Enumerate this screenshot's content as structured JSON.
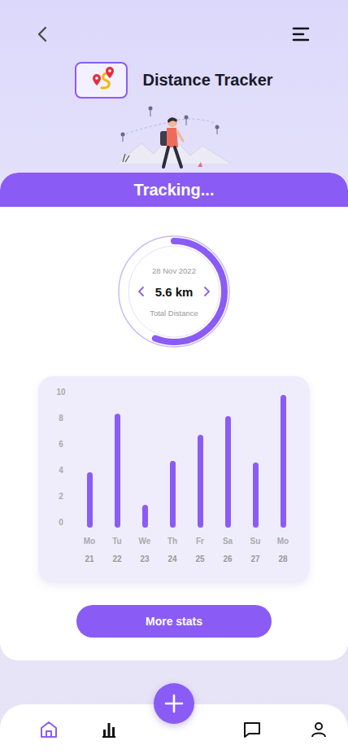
{
  "app": {
    "title": "Distance Tracker"
  },
  "status": "Tracking...",
  "summary": {
    "date": "28 Nov 2022",
    "distance": "5.6 km",
    "label": "Total Distance",
    "level": 0.56
  },
  "chart": {
    "y_ticks": [
      "10",
      "8",
      "6",
      "4",
      "2",
      "0"
    ],
    "x_labels": [
      {
        "day": "Mo",
        "date": "21"
      },
      {
        "day": "Tu",
        "date": "22"
      },
      {
        "day": "We",
        "date": "23"
      },
      {
        "day": "Th",
        "date": "24"
      },
      {
        "day": "Fr",
        "date": "25"
      },
      {
        "day": "Sa",
        "date": "26"
      },
      {
        "day": "Su",
        "date": "27"
      },
      {
        "day": "Mo",
        "date": "28"
      }
    ],
    "series": [
      {
        "name": "distance",
        "values": [
          3.9,
          8.4,
          1.4,
          4.75,
          6.75,
          8.2,
          4.6,
          9.8
        ]
      }
    ]
  },
  "button": "More stats",
  "nav": [
    {
      "kind": "home",
      "selected": true
    },
    {
      "kind": "stats",
      "selected": false
    },
    {
      "kind": "add",
      "selected": false
    },
    {
      "kind": "messages",
      "selected": false
    },
    {
      "kind": "profile",
      "selected": false
    }
  ]
}
